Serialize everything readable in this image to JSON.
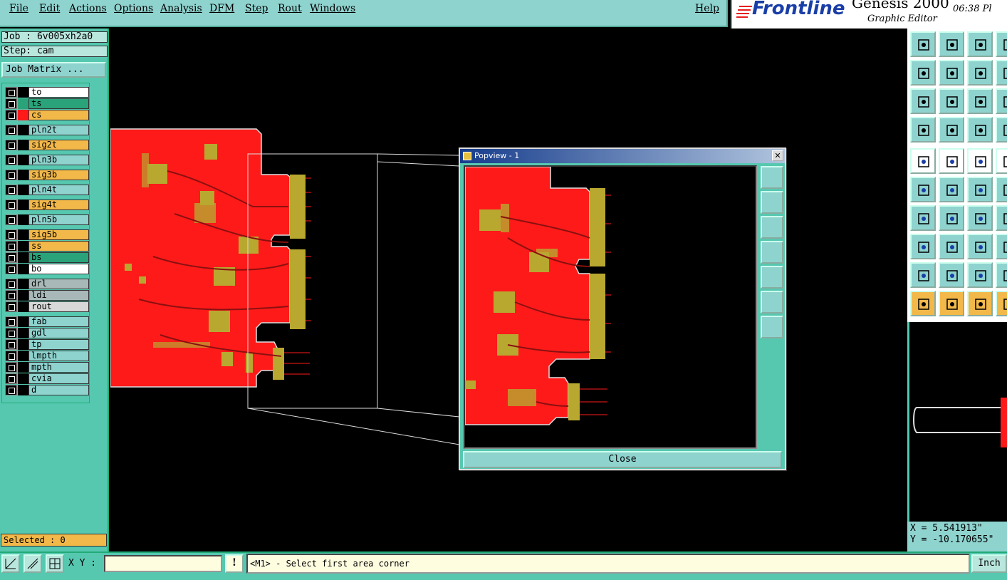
{
  "menu": {
    "items": [
      "File",
      "Edit",
      "Actions",
      "Options",
      "Analysis",
      "DFM",
      "Step",
      "Rout",
      "Windows"
    ],
    "help": "Help"
  },
  "brand": {
    "logo": "Frontline",
    "product": "Genesis 2000",
    "subtitle": "Graphic Editor",
    "time": "06:38 Pl"
  },
  "job": {
    "job_label": "Job : 6v005xh2a0",
    "step_label": "Step: cam",
    "matrix_button": "Job Matrix ..."
  },
  "layers": [
    {
      "name": "to",
      "color": "#ffffff",
      "swatch": "#000000"
    },
    {
      "name": "ts",
      "color": "#2aa37a",
      "swatch": "#2aa37a"
    },
    {
      "name": "cs",
      "color": "#f2b84a",
      "swatch": "#ff1a1a",
      "active": true
    },
    {
      "name": "pln2t",
      "color": "#8fd3cf",
      "swatch": "#000000"
    },
    {
      "name": "sig2t",
      "color": "#f2b84a",
      "swatch": "#000000"
    },
    {
      "name": "pln3b",
      "color": "#8fd3cf",
      "swatch": "#000000"
    },
    {
      "name": "sig3b",
      "color": "#f2b84a",
      "swatch": "#000000"
    },
    {
      "name": "pln4t",
      "color": "#8fd3cf",
      "swatch": "#000000"
    },
    {
      "name": "sig4t",
      "color": "#f2b84a",
      "swatch": "#000000"
    },
    {
      "name": "pln5b",
      "color": "#8fd3cf",
      "swatch": "#000000"
    },
    {
      "name": "sig5b",
      "color": "#f2b84a",
      "swatch": "#000000"
    },
    {
      "name": "ss",
      "color": "#f2b84a",
      "swatch": "#000000"
    },
    {
      "name": "bs",
      "color": "#2aa37a",
      "swatch": "#000000"
    },
    {
      "name": "bo",
      "color": "#ffffff",
      "swatch": "#000000"
    },
    {
      "name": "drl",
      "color": "#a8b8b8",
      "swatch": "#000000"
    },
    {
      "name": "ldi",
      "color": "#a8b8b8",
      "swatch": "#000000"
    },
    {
      "name": "rout",
      "color": "#d8d8d8",
      "swatch": "#000000"
    },
    {
      "name": "fab",
      "color": "#8fd3cf",
      "swatch": "#000000"
    },
    {
      "name": "gdl",
      "color": "#8fd3cf",
      "swatch": "#000000"
    },
    {
      "name": "tp",
      "color": "#8fd3cf",
      "swatch": "#000000"
    },
    {
      "name": "lmpth",
      "color": "#8fd3cf",
      "swatch": "#000000"
    },
    {
      "name": "mpth",
      "color": "#8fd3cf",
      "swatch": "#000000"
    },
    {
      "name": "cvia",
      "color": "#8fd3cf",
      "swatch": "#000000"
    },
    {
      "name": "d",
      "color": "#8fd3cf",
      "swatch": "#000000"
    }
  ],
  "selected": "Selected : 0",
  "popview": {
    "title": "Popview - 1",
    "close_x": "✕",
    "close_button": "Close"
  },
  "coords": {
    "x": "X = 5.541913\"",
    "y": "Y = -10.170655\""
  },
  "bottom": {
    "xy_label": "X Y :",
    "xy_value": "",
    "message": "<M1> - Select first area corner",
    "units": "Inch"
  },
  "colors": {
    "board": "#ff1a1a",
    "copper": "#b8a830",
    "panel": "#56c8b0"
  }
}
